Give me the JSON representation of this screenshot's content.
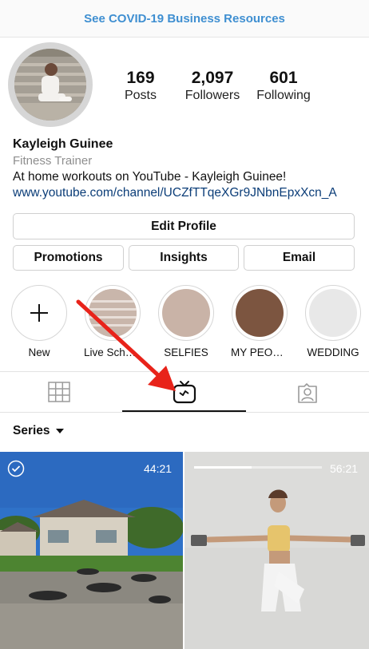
{
  "banner": {
    "text": "See COVID-19 Business Resources"
  },
  "stats": [
    {
      "value": "169",
      "label": "Posts"
    },
    {
      "value": "2,097",
      "label": "Followers"
    },
    {
      "value": "601",
      "label": "Following"
    }
  ],
  "profile": {
    "name": "Kayleigh Guinee",
    "category": "Fitness Trainer",
    "bio": "At home workouts on YouTube - Kayleigh Guinee!",
    "link": "www.youtube.com/channel/UCZfTTqeXGr9JNbnEpxXcn_A"
  },
  "buttons": {
    "edit_profile": "Edit Profile",
    "promotions": "Promotions",
    "insights": "Insights",
    "email": "Email"
  },
  "highlights": [
    {
      "label": "New",
      "icon": "plus-icon"
    },
    {
      "label": "Live Sched...",
      "color": "#c7b4aa"
    },
    {
      "label": "SELFIES",
      "color": "#c9b3a7"
    },
    {
      "label": "MY PEOPLE",
      "color": "#7c5540"
    },
    {
      "label": "WEDDING",
      "color": "#e8e8e8"
    }
  ],
  "tabs": {
    "active": "igtv",
    "items": [
      "grid-icon",
      "igtv-icon",
      "tagged-icon"
    ]
  },
  "series": {
    "label": "Series"
  },
  "videos": [
    {
      "duration": "44:21",
      "selected": true
    },
    {
      "duration": "56:21",
      "progress": 0.45
    }
  ],
  "colors": {
    "link": "#0b3d78",
    "banner": "#3f8fd1",
    "arrow": "#e8231a"
  }
}
